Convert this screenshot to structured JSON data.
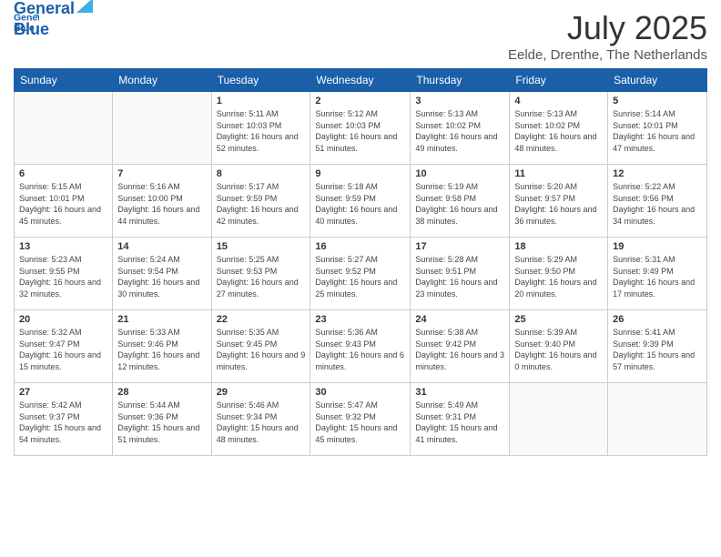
{
  "header": {
    "logo_general": "General",
    "logo_blue": "Blue",
    "month": "July 2025",
    "location": "Eelde, Drenthe, The Netherlands"
  },
  "weekdays": [
    "Sunday",
    "Monday",
    "Tuesday",
    "Wednesday",
    "Thursday",
    "Friday",
    "Saturday"
  ],
  "weeks": [
    [
      {
        "day": "",
        "info": ""
      },
      {
        "day": "",
        "info": ""
      },
      {
        "day": "1",
        "info": "Sunrise: 5:11 AM\nSunset: 10:03 PM\nDaylight: 16 hours and 52 minutes."
      },
      {
        "day": "2",
        "info": "Sunrise: 5:12 AM\nSunset: 10:03 PM\nDaylight: 16 hours and 51 minutes."
      },
      {
        "day": "3",
        "info": "Sunrise: 5:13 AM\nSunset: 10:02 PM\nDaylight: 16 hours and 49 minutes."
      },
      {
        "day": "4",
        "info": "Sunrise: 5:13 AM\nSunset: 10:02 PM\nDaylight: 16 hours and 48 minutes."
      },
      {
        "day": "5",
        "info": "Sunrise: 5:14 AM\nSunset: 10:01 PM\nDaylight: 16 hours and 47 minutes."
      }
    ],
    [
      {
        "day": "6",
        "info": "Sunrise: 5:15 AM\nSunset: 10:01 PM\nDaylight: 16 hours and 45 minutes."
      },
      {
        "day": "7",
        "info": "Sunrise: 5:16 AM\nSunset: 10:00 PM\nDaylight: 16 hours and 44 minutes."
      },
      {
        "day": "8",
        "info": "Sunrise: 5:17 AM\nSunset: 9:59 PM\nDaylight: 16 hours and 42 minutes."
      },
      {
        "day": "9",
        "info": "Sunrise: 5:18 AM\nSunset: 9:59 PM\nDaylight: 16 hours and 40 minutes."
      },
      {
        "day": "10",
        "info": "Sunrise: 5:19 AM\nSunset: 9:58 PM\nDaylight: 16 hours and 38 minutes."
      },
      {
        "day": "11",
        "info": "Sunrise: 5:20 AM\nSunset: 9:57 PM\nDaylight: 16 hours and 36 minutes."
      },
      {
        "day": "12",
        "info": "Sunrise: 5:22 AM\nSunset: 9:56 PM\nDaylight: 16 hours and 34 minutes."
      }
    ],
    [
      {
        "day": "13",
        "info": "Sunrise: 5:23 AM\nSunset: 9:55 PM\nDaylight: 16 hours and 32 minutes."
      },
      {
        "day": "14",
        "info": "Sunrise: 5:24 AM\nSunset: 9:54 PM\nDaylight: 16 hours and 30 minutes."
      },
      {
        "day": "15",
        "info": "Sunrise: 5:25 AM\nSunset: 9:53 PM\nDaylight: 16 hours and 27 minutes."
      },
      {
        "day": "16",
        "info": "Sunrise: 5:27 AM\nSunset: 9:52 PM\nDaylight: 16 hours and 25 minutes."
      },
      {
        "day": "17",
        "info": "Sunrise: 5:28 AM\nSunset: 9:51 PM\nDaylight: 16 hours and 23 minutes."
      },
      {
        "day": "18",
        "info": "Sunrise: 5:29 AM\nSunset: 9:50 PM\nDaylight: 16 hours and 20 minutes."
      },
      {
        "day": "19",
        "info": "Sunrise: 5:31 AM\nSunset: 9:49 PM\nDaylight: 16 hours and 17 minutes."
      }
    ],
    [
      {
        "day": "20",
        "info": "Sunrise: 5:32 AM\nSunset: 9:47 PM\nDaylight: 16 hours and 15 minutes."
      },
      {
        "day": "21",
        "info": "Sunrise: 5:33 AM\nSunset: 9:46 PM\nDaylight: 16 hours and 12 minutes."
      },
      {
        "day": "22",
        "info": "Sunrise: 5:35 AM\nSunset: 9:45 PM\nDaylight: 16 hours and 9 minutes."
      },
      {
        "day": "23",
        "info": "Sunrise: 5:36 AM\nSunset: 9:43 PM\nDaylight: 16 hours and 6 minutes."
      },
      {
        "day": "24",
        "info": "Sunrise: 5:38 AM\nSunset: 9:42 PM\nDaylight: 16 hours and 3 minutes."
      },
      {
        "day": "25",
        "info": "Sunrise: 5:39 AM\nSunset: 9:40 PM\nDaylight: 16 hours and 0 minutes."
      },
      {
        "day": "26",
        "info": "Sunrise: 5:41 AM\nSunset: 9:39 PM\nDaylight: 15 hours and 57 minutes."
      }
    ],
    [
      {
        "day": "27",
        "info": "Sunrise: 5:42 AM\nSunset: 9:37 PM\nDaylight: 15 hours and 54 minutes."
      },
      {
        "day": "28",
        "info": "Sunrise: 5:44 AM\nSunset: 9:36 PM\nDaylight: 15 hours and 51 minutes."
      },
      {
        "day": "29",
        "info": "Sunrise: 5:46 AM\nSunset: 9:34 PM\nDaylight: 15 hours and 48 minutes."
      },
      {
        "day": "30",
        "info": "Sunrise: 5:47 AM\nSunset: 9:32 PM\nDaylight: 15 hours and 45 minutes."
      },
      {
        "day": "31",
        "info": "Sunrise: 5:49 AM\nSunset: 9:31 PM\nDaylight: 15 hours and 41 minutes."
      },
      {
        "day": "",
        "info": ""
      },
      {
        "day": "",
        "info": ""
      }
    ]
  ]
}
